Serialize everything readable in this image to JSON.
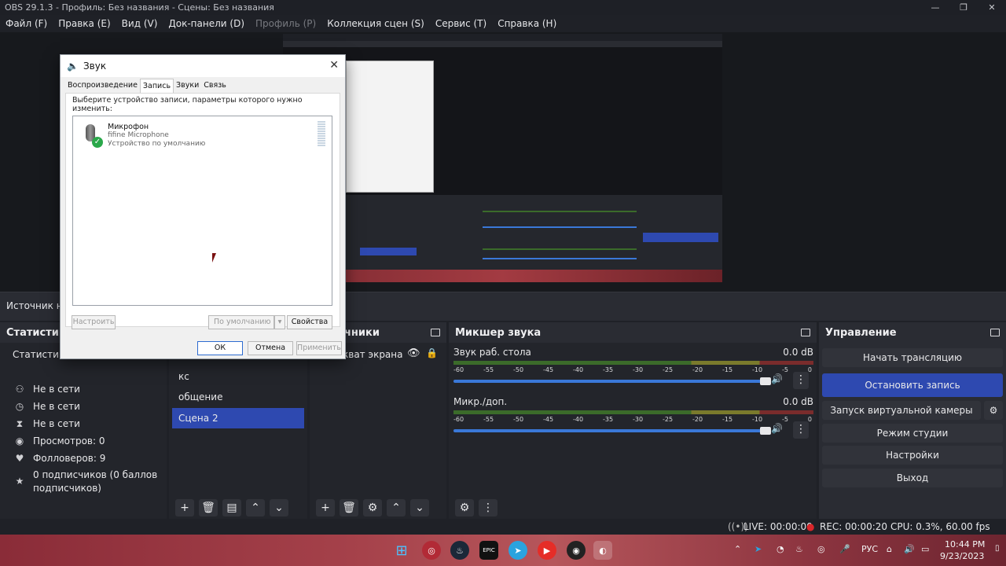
{
  "window": {
    "title": "OBS 29.1.3 - Профиль: Без названия - Сцены: Без названия"
  },
  "menu": [
    {
      "label": "Файл (F)",
      "disabled": false
    },
    {
      "label": "Правка (E)",
      "disabled": false
    },
    {
      "label": "Вид (V)",
      "disabled": false
    },
    {
      "label": "Док-панели (D)",
      "disabled": false
    },
    {
      "label": "Профиль (P)",
      "disabled": true
    },
    {
      "label": "Коллекция сцен (S)",
      "disabled": false
    },
    {
      "label": "Сервис (T)",
      "disabled": false
    },
    {
      "label": "Справка (H)",
      "disabled": false
    }
  ],
  "source_bar": {
    "text": "Источник не"
  },
  "stats": {
    "title": "Статистика",
    "tab_label": "Статисти",
    "items": [
      {
        "icon": "user-icon",
        "text": "Не в сети"
      },
      {
        "icon": "clock-icon",
        "text": "Не в сети"
      },
      {
        "icon": "hourglass-icon",
        "text": "Не в сети"
      },
      {
        "icon": "eye-icon",
        "text": "Просмотров: 0"
      },
      {
        "icon": "heart-icon",
        "text": "Фолловеров: 9"
      },
      {
        "icon": "star-icon",
        "text": "0 подписчиков (0 баллов подписчиков)"
      }
    ]
  },
  "scenes": {
    "items": [
      {
        "label": "кс",
        "selected": false
      },
      {
        "label": "общение",
        "selected": false
      },
      {
        "label": "Сцена 2",
        "selected": true
      }
    ]
  },
  "sources": {
    "title": "чники",
    "items": [
      {
        "label": "кват экрана"
      }
    ]
  },
  "mixer": {
    "title": "Микшер звука",
    "channels": [
      {
        "name": "Звук раб. стола",
        "level": "0.0 dB"
      },
      {
        "name": "Микр./доп.",
        "level": "0.0 dB"
      }
    ],
    "ticks": [
      "-60",
      "-55",
      "-50",
      "-45",
      "-40",
      "-35",
      "-30",
      "-25",
      "-20",
      "-15",
      "-10",
      "-5",
      "0"
    ]
  },
  "controls": {
    "title": "Управление",
    "buttons": [
      {
        "label": "Начать трансляцию",
        "active": false
      },
      {
        "label": "Остановить запись",
        "active": true
      },
      {
        "label": "Запуск виртуальной камеры",
        "active": false
      },
      {
        "label": "Режим студии",
        "active": false
      },
      {
        "label": "Настройки",
        "active": false
      },
      {
        "label": "Выход",
        "active": false
      }
    ]
  },
  "status": {
    "live": "LIVE: 00:00:00",
    "rec": "REC: 00:00:20",
    "cpu": "CPU: 0.3%, 60.00 fps"
  },
  "taskbar": {
    "lang": "РУС",
    "time": "10:44 PM",
    "date": "9/23/2023"
  },
  "sound_dialog": {
    "title": "Звук",
    "tabs": [
      {
        "label": "Воспроизведение",
        "active": false
      },
      {
        "label": "Запись",
        "active": true
      },
      {
        "label": "Звуки",
        "active": false
      },
      {
        "label": "Связь",
        "active": false
      }
    ],
    "instruction": "Выберите устройство записи, параметры которого нужно изменить:",
    "device": {
      "name": "Микрофон",
      "model": "fifine Microphone",
      "status": "Устройство по умолчанию"
    },
    "configure": "Настроить",
    "set_default": "По умолчанию",
    "properties": "Свойства",
    "ok": "ОК",
    "cancel": "Отмена",
    "apply": "Применить"
  }
}
